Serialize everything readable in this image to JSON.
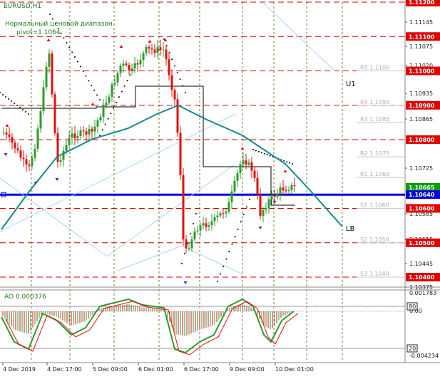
{
  "window": {
    "symbol_label": "EURUSD,H1",
    "note_line1": "Нормальный ценовой диапазон",
    "note_line2": "pivot=1.1064"
  },
  "colors": {
    "background": "#ffffff",
    "candle_bull": "#2e9b2e",
    "candle_bear": "#e01010",
    "ma_line": "#138a8a",
    "pivot_line": "#0000dd",
    "level_line": "#cc0000",
    "price_badge": "#e00000",
    "current_badge": "#0000dd",
    "ao_line": "#2e9b2e",
    "ao_signal": "#e01010",
    "grid": "#7a7a3a",
    "trend_line": "#a8d8e8"
  },
  "price_axis": {
    "plain_labels": [
      "1.11145",
      "1.11075",
      "1.11020",
      "1.10935",
      "1.10865",
      "1.10725",
      "1.10585",
      "1.10515",
      "1.10445",
      "1.10375"
    ],
    "level_badges": [
      "1.11200",
      "1.11100",
      "1.11000",
      "1.10900",
      "1.10800",
      "1.10600",
      "1.10500",
      "1.10400"
    ],
    "current_price": "1.10665",
    "pivot_badge": "1.10640"
  },
  "pivot_levels": [
    {
      "name": "R5",
      "label": "R5 1.1100",
      "value": 1.11
    },
    {
      "name": "R4",
      "label": "R4 1.1090",
      "value": 1.109
    },
    {
      "name": "R3",
      "label": "R3 1.1085",
      "value": 1.1085
    },
    {
      "name": "R2",
      "label": "R2 1.1075",
      "value": 1.1075
    },
    {
      "name": "R1",
      "label": "R1 1.1069",
      "value": 1.1069
    },
    {
      "name": "S1",
      "label": "S1 1.1060",
      "value": 1.106
    },
    {
      "name": "S2",
      "label": "S2 1.1050",
      "value": 1.105
    },
    {
      "name": "S3",
      "label": "S3 1.1040",
      "value": 1.104
    }
  ],
  "band_labels": {
    "upper": "U1",
    "lower": "LB"
  },
  "indicator": {
    "title": "AO 0.000376",
    "axis_top": "0.001783",
    "axis_zero": "0.00",
    "axis_bottom": "-0.004234",
    "level_high": "80",
    "level_low": "20"
  },
  "time_axis": [
    "4 Dec 2019",
    "4 Dec 17:00",
    "5 Dec 09:00",
    "6 Dec 01:00",
    "6 Dec 17:00",
    "9 Dec 09:00",
    "10 Dec 01:00"
  ]
}
